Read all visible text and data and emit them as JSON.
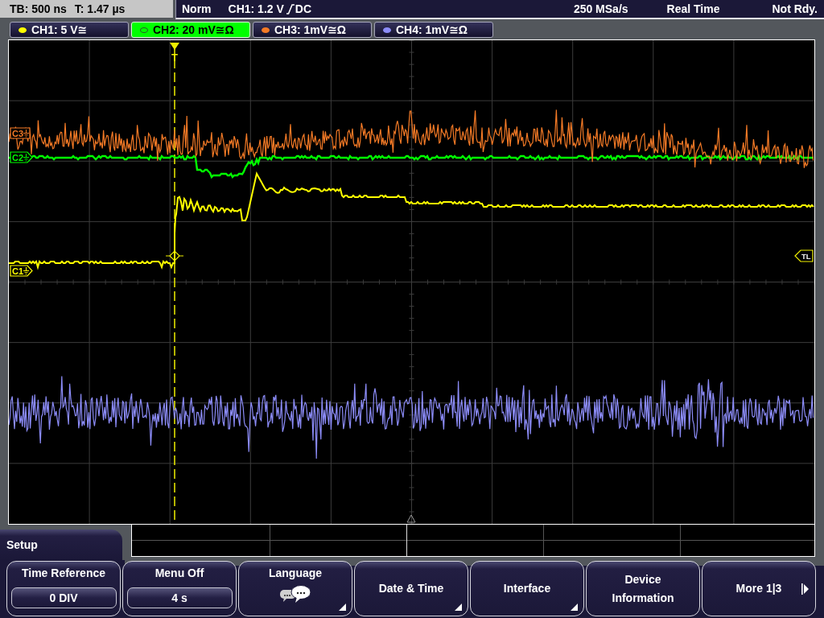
{
  "status_bar": {
    "timebase": "TB: 500 ns",
    "trigger_offset": "T: 1.47 µs",
    "trigger_mode": "Norm",
    "trigger_source": "CH1: 1.2 V",
    "trigger_coupling": "DC",
    "sample_rate": "250 MSa/s",
    "acquisition_mode": "Real Time",
    "status": "Not Rdy."
  },
  "channels": [
    {
      "label": "CH1: 5 V≅",
      "color": "#ffff00",
      "selected": false
    },
    {
      "label": "CH2: 20 mV≅Ω",
      "color": "#00ff00",
      "selected": true
    },
    {
      "label": "CH3: 1mV≅Ω",
      "color": "#f47a26",
      "selected": false
    },
    {
      "label": "CH4: 1mV≅Ω",
      "color": "#8c8cf8",
      "selected": false
    }
  ],
  "display": {
    "trigger_marker": "T",
    "channel_markers": [
      {
        "label": "C3",
        "color": "#f47a26"
      },
      {
        "label": "C2",
        "color": "#00ff00"
      },
      {
        "label": "C1",
        "color": "#ffff00"
      }
    ],
    "trigger_level_marker": "TL"
  },
  "menu": {
    "title": "Setup"
  },
  "softkeys": [
    {
      "kind": "value",
      "label": "Time Reference",
      "value": "0 DIV"
    },
    {
      "kind": "value",
      "label": "Menu Off",
      "value": "4 s"
    },
    {
      "kind": "icon",
      "label": "Language",
      "submenu": true
    },
    {
      "kind": "text",
      "label": "Date & Time",
      "submenu": true
    },
    {
      "kind": "text",
      "label": "Interface",
      "submenu": true
    },
    {
      "kind": "text",
      "label": "Device Information",
      "submenu": false
    },
    {
      "kind": "next",
      "label": "More 1|3"
    }
  ]
}
